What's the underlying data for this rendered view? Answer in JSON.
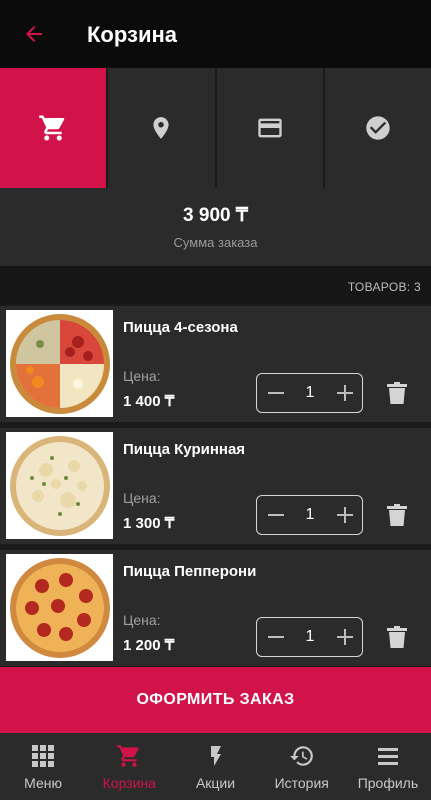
{
  "header": {
    "title": "Корзина",
    "back_icon": "arrow-left-icon"
  },
  "steps": [
    {
      "icon": "cart-icon",
      "active": true
    },
    {
      "icon": "location-pin-icon",
      "active": false
    },
    {
      "icon": "credit-card-icon",
      "active": false
    },
    {
      "icon": "check-circle-icon",
      "active": false
    }
  ],
  "summary": {
    "total": "3 900 ₸",
    "label": "Сумма заказа"
  },
  "items_count": "ТОВАРОВ: 3",
  "cart_items": [
    {
      "name": "Пицца 4-сезона",
      "price_label": "Цена:",
      "price": "1 400 ₸",
      "quantity": "1"
    },
    {
      "name": "Пицца Куринная",
      "price_label": "Цена:",
      "price": "1 300 ₸",
      "quantity": "1"
    },
    {
      "name": "Пицца Пепперони",
      "price_label": "Цена:",
      "price": "1 200 ₸",
      "quantity": "1"
    }
  ],
  "checkout_label": "ОФОРМИТЬ ЗАКАЗ",
  "tabs": [
    {
      "label": "Меню",
      "icon": "grid-icon",
      "active": false
    },
    {
      "label": "Корзина",
      "icon": "cart-icon",
      "active": true
    },
    {
      "label": "Акции",
      "icon": "lightning-icon",
      "active": false
    },
    {
      "label": "История",
      "icon": "history-icon",
      "active": false
    },
    {
      "label": "Профиль",
      "icon": "menu-icon",
      "active": false
    }
  ],
  "colors": {
    "accent": "#d1134a",
    "background": "#1b1b1b",
    "surface": "#2b2b2b",
    "appbar": "#0b0b0b"
  }
}
